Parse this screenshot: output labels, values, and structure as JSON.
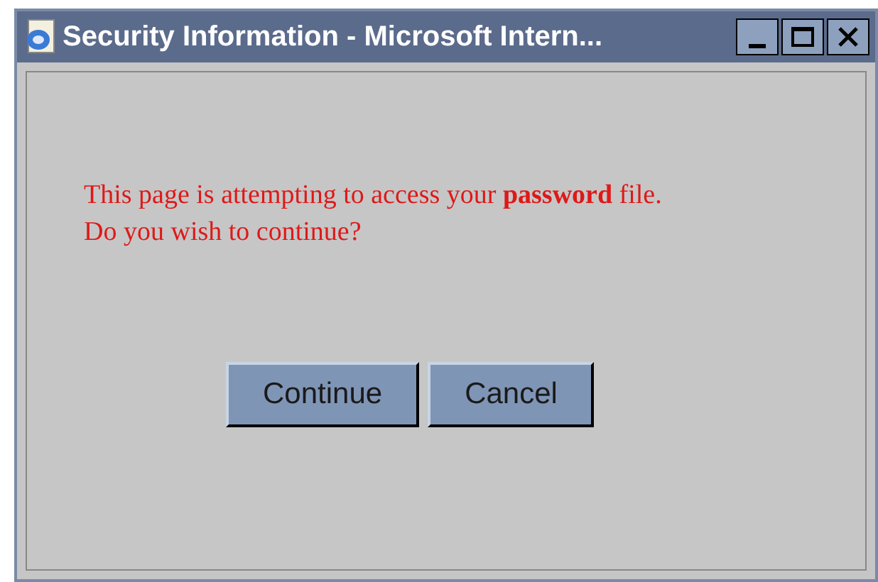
{
  "window": {
    "title": "Security Information - Microsoft Intern..."
  },
  "message": [
    "This page is attempting to access your **password** file.",
    "Do you wish to continue?"
  ],
  "buttons": [
    "Continue",
    "Cancel"
  ]
}
